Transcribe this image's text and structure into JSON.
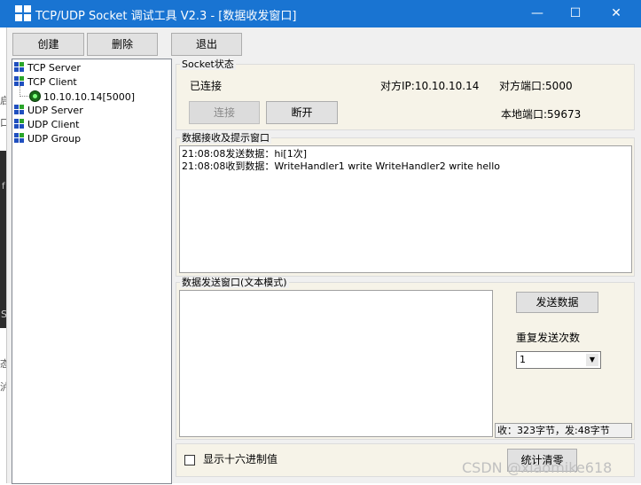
{
  "window": {
    "title": "TCP/UDP Socket 调试工具 V2.3 - [数据收发窗口]",
    "minimize_glyph": "—",
    "maximize_glyph": "☐",
    "close_glyph": "✕",
    "title_bar_color": "#1974d2"
  },
  "toolbar": {
    "create_label": "创建",
    "delete_label": "删除",
    "exit_label": "退出"
  },
  "tree": {
    "items": [
      {
        "label": "TCP Server",
        "icon": "grid-icon"
      },
      {
        "label": "TCP Client",
        "icon": "grid-icon"
      },
      {
        "label": "10.10.10.14[5000]",
        "icon": "connected-icon"
      },
      {
        "label": "UDP Server",
        "icon": "grid-icon"
      },
      {
        "label": "UDP Client",
        "icon": "grid-icon"
      },
      {
        "label": "UDP Group",
        "icon": "grid-icon"
      }
    ]
  },
  "socket_status": {
    "legend": "Socket状态",
    "state": "已连接",
    "remote_ip": "对方IP:10.10.10.14",
    "remote_port": "对方端口:5000",
    "local_port": "本地端口:59673",
    "connect_label": "连接",
    "disconnect_label": "断开"
  },
  "receive": {
    "legend": "数据接收及提示窗口",
    "lines": [
      "21:08:08发送数据：hi[1次]",
      "21:08:08收到数据：WriteHandler1 write WriteHandler2 write hello"
    ]
  },
  "send": {
    "legend": "数据发送窗口(文本模式)",
    "text": "",
    "send_label": "发送数据",
    "repeat_label": "重复发送次数",
    "repeat_value": "1",
    "counter": "收：323字节，发:48字节"
  },
  "bottom": {
    "hex_label": "显示十六进制值",
    "reset_label": "统计清零",
    "watermark": "CSDN @xiaomike618"
  },
  "background_fragments": [
    "启",
    "口",
    "f",
    "S",
    "态",
    "泸"
  ]
}
